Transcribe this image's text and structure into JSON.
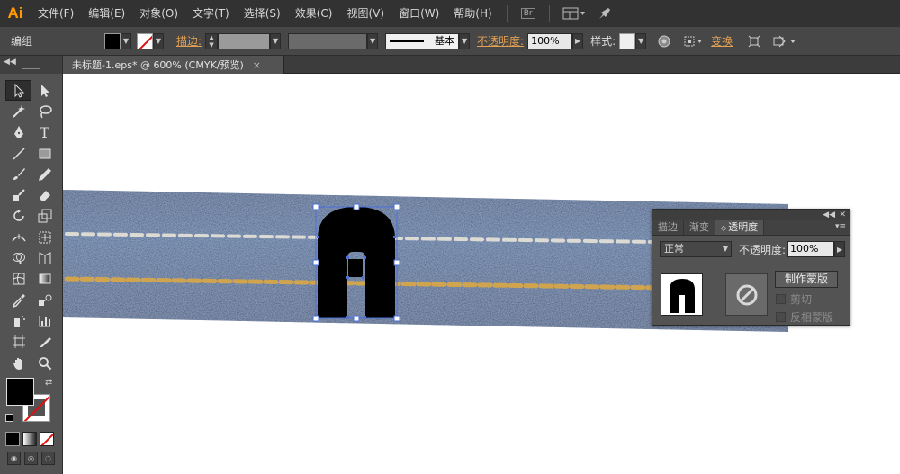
{
  "app": {
    "logo": "Ai"
  },
  "menu": {
    "items": [
      "文件(F)",
      "编辑(E)",
      "对象(O)",
      "文字(T)",
      "选择(S)",
      "效果(C)",
      "视图(V)",
      "窗口(W)",
      "帮助(H)"
    ],
    "br_label": "Br"
  },
  "control_bar": {
    "group_label": "编组",
    "stroke_label": "描边:",
    "stroke_style_label": "基本",
    "opacity_label": "不透明度:",
    "opacity_value": "100%",
    "style_label": "样式:",
    "transform_label": "变换"
  },
  "document": {
    "tab_title": "未标题-1.eps* @ 600% (CMYK/预览)",
    "close_glyph": "×"
  },
  "tools": {
    "type_glyph": "T"
  },
  "transparency_panel": {
    "tabs": [
      "描边",
      "渐变",
      "透明度"
    ],
    "blend_mode": "正常",
    "opacity_label": "不透明度:",
    "opacity_value": "100%",
    "make_mask_button": "制作蒙版",
    "clip_label": "剪切",
    "invert_mask_label": "反相蒙版"
  },
  "colors": {
    "accent_orange": "#e2a052",
    "denim": "#2f4a73",
    "stitch_white": "#e8e4d8",
    "stitch_gold": "#d6a64a",
    "selection_blue": "#4a6fd8"
  }
}
